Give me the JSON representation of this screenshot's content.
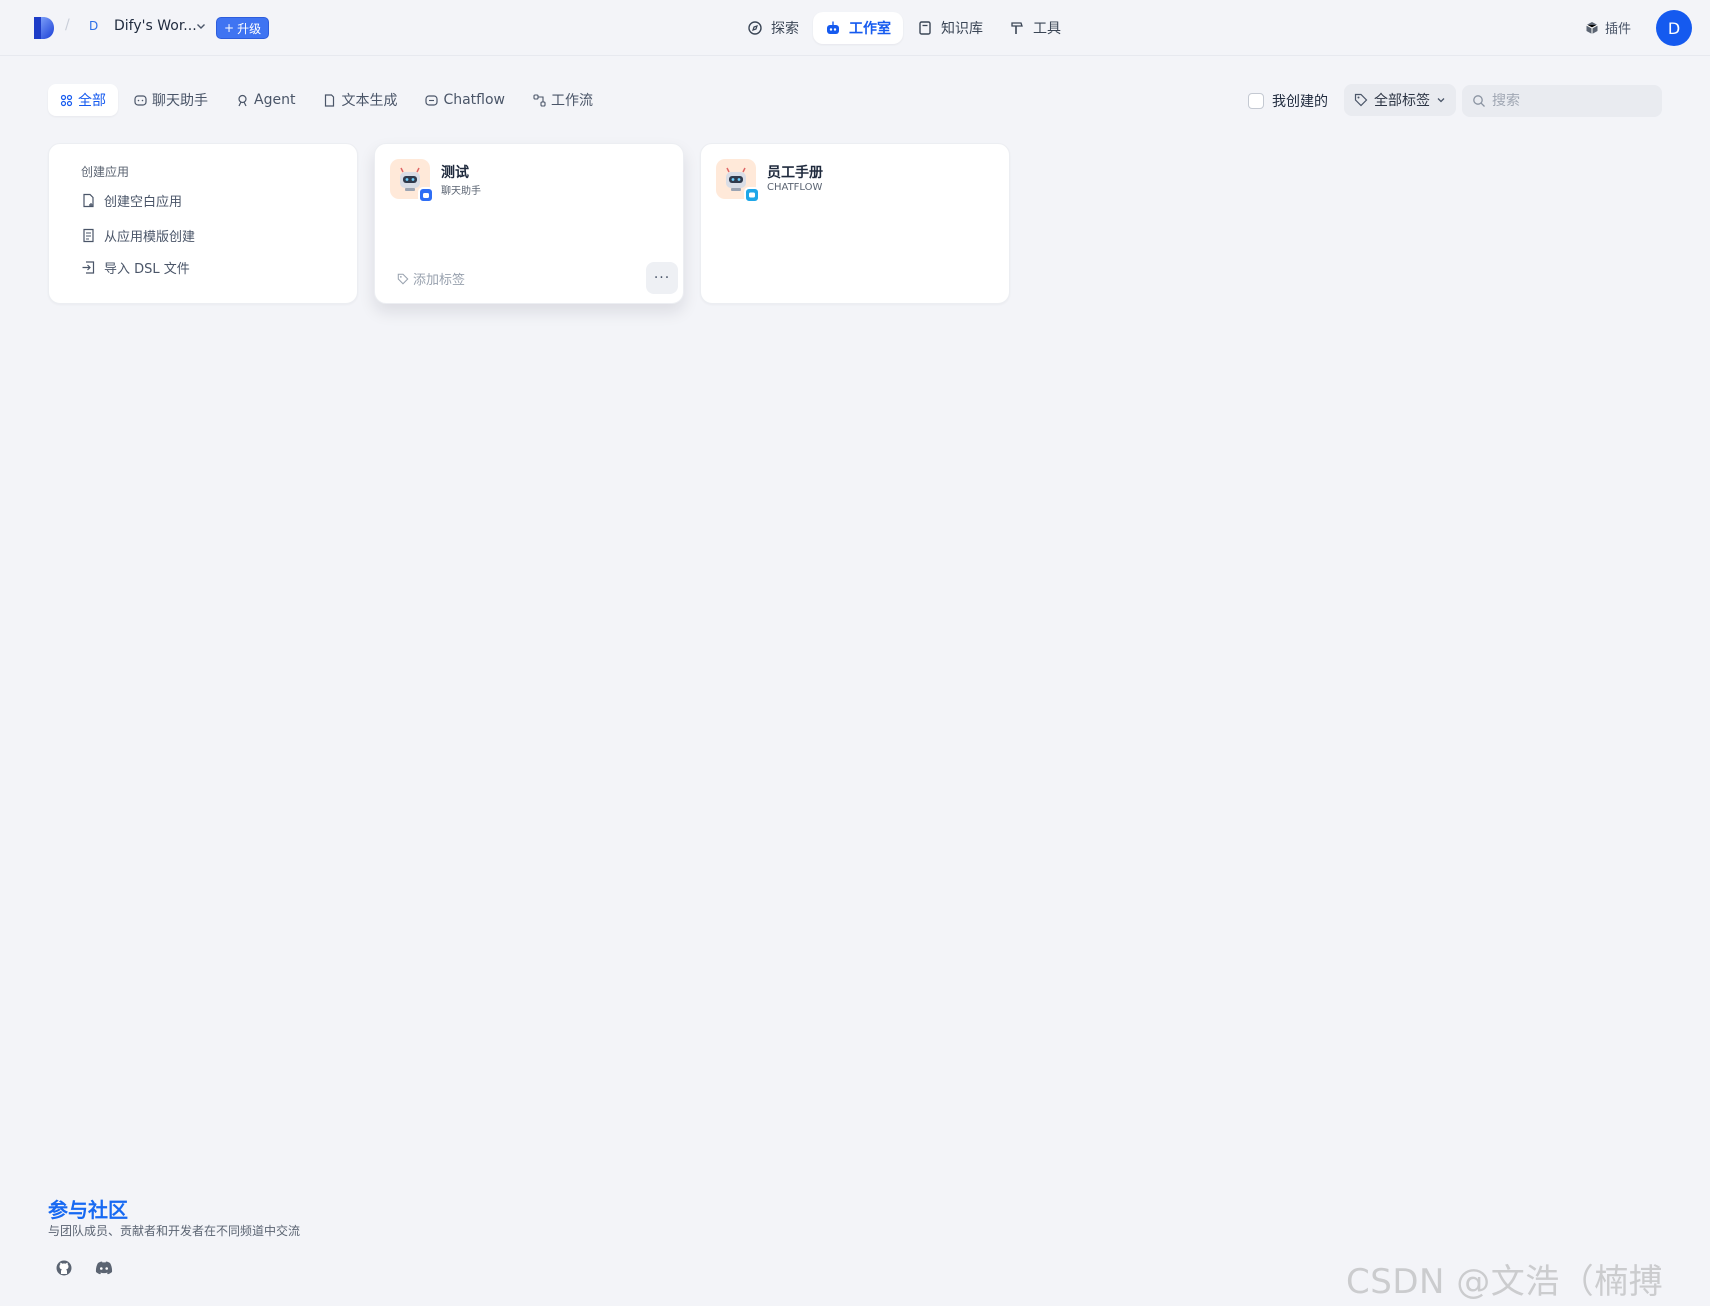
{
  "header": {
    "crumb_separator": "/",
    "workspace_initial": "D",
    "workspace_name": "Dify's Wor...",
    "upgrade_label": "升级",
    "nav": [
      {
        "label": "探索",
        "icon": "compass-icon"
      },
      {
        "label": "工作室",
        "icon": "robot-icon",
        "active": true
      },
      {
        "label": "知识库",
        "icon": "book-icon"
      },
      {
        "label": "工具",
        "icon": "hammer-icon"
      }
    ],
    "plugins_label": "插件",
    "avatar_initial": "D"
  },
  "filters": {
    "tabs": [
      {
        "label": "全部",
        "icon": "grid-icon",
        "active": true
      },
      {
        "label": "聊天助手",
        "icon": "chat-icon"
      },
      {
        "label": "Agent",
        "icon": "agent-icon"
      },
      {
        "label": "文本生成",
        "icon": "document-icon"
      },
      {
        "label": "Chatflow",
        "icon": "chat-icon"
      },
      {
        "label": "工作流",
        "icon": "workflow-icon"
      }
    ],
    "mine_label": "我创建的",
    "tag_filter_label": "全部标签",
    "search_placeholder": "搜索"
  },
  "create": {
    "title": "创建应用",
    "items": [
      {
        "label": "创建空白应用",
        "icon": "file-plus-icon"
      },
      {
        "label": "从应用模版创建",
        "icon": "template-icon"
      },
      {
        "label": "导入 DSL 文件",
        "icon": "import-icon"
      }
    ]
  },
  "apps": [
    {
      "name": "测试",
      "type": "聊天助手",
      "badge_color": "#2f6ef5",
      "add_tag_label": "添加标签",
      "more_label": "···"
    },
    {
      "name": "员工手册",
      "type": "CHATFLOW",
      "badge_color": "#1fa7e8"
    }
  ],
  "footer": {
    "title": "参与社区",
    "description": "与团队成员、贡献者和开发者在不同频道中交流",
    "links": [
      "github-icon",
      "discord-icon"
    ]
  },
  "watermark": "CSDN @文浩（楠搏万）",
  "colors": {
    "accent": "#155aef",
    "background": "#f3f4f8",
    "upgrade": "#3f74f2"
  }
}
